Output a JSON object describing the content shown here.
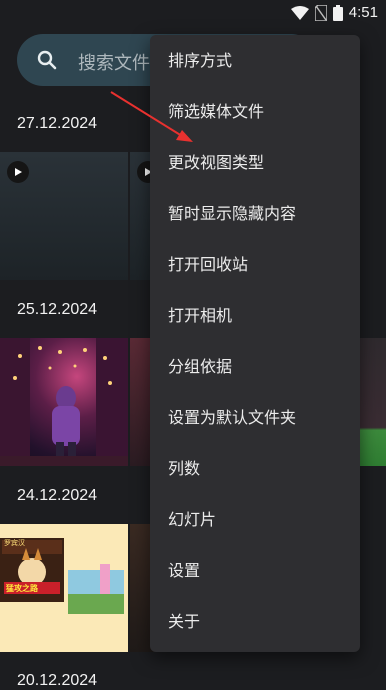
{
  "status_bar": {
    "time": "4:51"
  },
  "search": {
    "placeholder": "搜索文件"
  },
  "sections": [
    {
      "date": "27.12.2024"
    },
    {
      "date": "25.12.2024"
    },
    {
      "date": "24.12.2024"
    },
    {
      "date": "20.12.2024"
    }
  ],
  "thumb_text": {
    "poster_top": "罗宾汉",
    "poster_main": "猛攻之路"
  },
  "menu": {
    "items": [
      "排序方式",
      "筛选媒体文件",
      "更改视图类型",
      "暂时显示隐藏内容",
      "打开回收站",
      "打开相机",
      "分组依据",
      "设置为默认文件夹",
      "列数",
      "幻灯片",
      "设置",
      "关于"
    ]
  },
  "colors": {
    "background": "#1c1d20",
    "search_bg": "#2f4651",
    "menu_bg": "#2e2e31",
    "annotation_arrow": "#e8312f"
  }
}
